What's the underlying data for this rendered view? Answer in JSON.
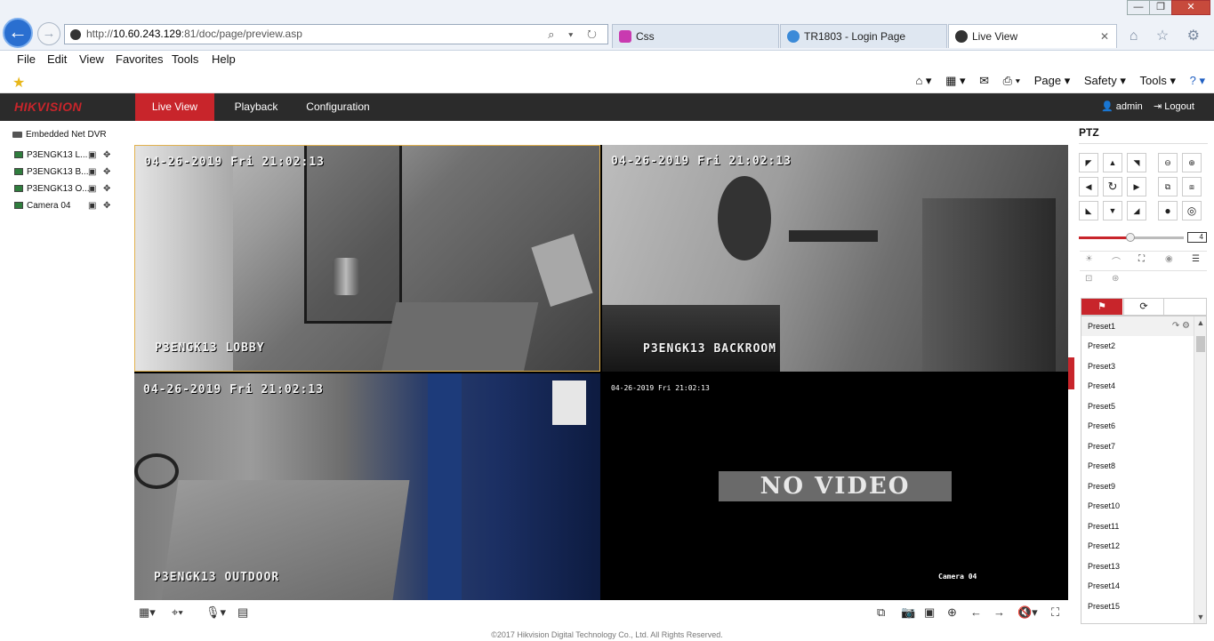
{
  "browser": {
    "address_prefix": "http://",
    "address_host": "10.60.243.129",
    "address_rest": ":81/doc/page/preview.asp",
    "address_ctrls": "⌕ ▾ ↻",
    "tabs": [
      {
        "label": "Css",
        "icon_color": "#c93ab0"
      },
      {
        "label": "TR1803 - Login Page",
        "icon_color": "#3b8ad8"
      },
      {
        "label": "Live View",
        "icon_color": "#333333"
      }
    ],
    "tab_close": "✕",
    "window_buttons": [
      "—",
      "❐",
      "✕"
    ],
    "nav_icons": "⌂ ☆ ⚙",
    "menu": [
      "File",
      "Edit",
      "View",
      "Favorites",
      "Tools",
      "Help"
    ],
    "command_bar": [
      "⌂ ▾",
      "▦ ▾",
      "✉",
      "⎙ ▾",
      "Page ▾",
      "Safety ▾",
      "Tools ▾",
      "? ▾"
    ]
  },
  "app": {
    "logo": "HIKVISION",
    "nav": [
      "Live View",
      "Playback",
      "Configuration"
    ],
    "user": "admin",
    "logout": "Logout",
    "accent": "#c8252b"
  },
  "device_tree": {
    "root": "Embedded Net DVR",
    "cameras": [
      "P3ENGK13 L...",
      "P3ENGK13 B...",
      "P3ENGK13 O...",
      "Camera 04"
    ]
  },
  "video": {
    "panes": [
      {
        "timestamp": "04-26-2019 Fri 21:02:13",
        "name": "P3ENGK13 LOBBY"
      },
      {
        "timestamp": "04-26-2019 Fri 21:02:13",
        "name": "P3ENGK13 BACKROOM"
      },
      {
        "timestamp": "04-26-2019 Fri 21:02:13",
        "name": "P3ENGK13 OUTDOOR"
      },
      {
        "timestamp": "04-26-2019 Fri 21:02:13",
        "name": "Camera 04",
        "status": "NO VIDEO"
      }
    ]
  },
  "ptz": {
    "title": "PTZ",
    "speed": "4",
    "speed_level": 0.45,
    "preset_tabs": [
      "⚑",
      "⟳"
    ],
    "presets": [
      "Preset1",
      "Preset2",
      "Preset3",
      "Preset4",
      "Preset5",
      "Preset6",
      "Preset7",
      "Preset8",
      "Preset9",
      "Preset10",
      "Preset11",
      "Preset12",
      "Preset13",
      "Preset14",
      "Preset15"
    ],
    "preset_actions": [
      "↷",
      "⚙"
    ]
  },
  "footer": "©2017 Hikvision Digital Technology Co., Ltd. All Rights Reserved."
}
